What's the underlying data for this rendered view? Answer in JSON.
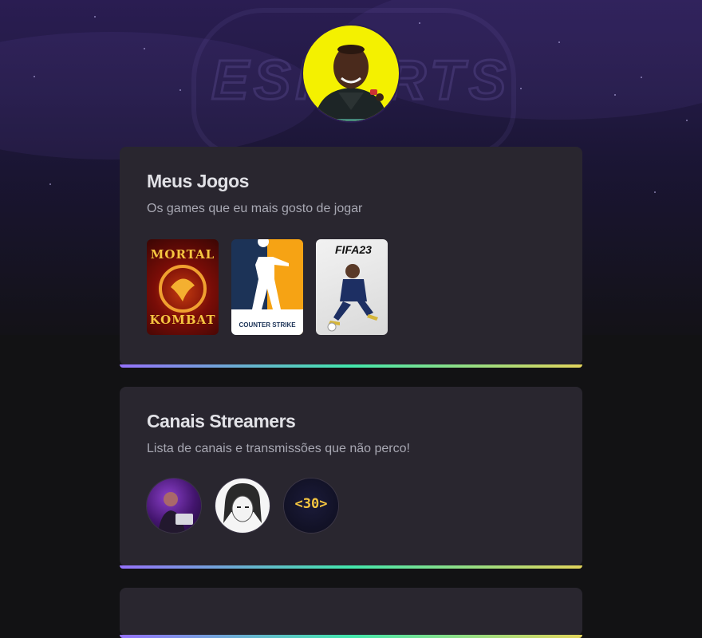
{
  "profile": {
    "avatar_icon": "profile-photo"
  },
  "games_section": {
    "title": "Meus Jogos",
    "subtitle": "Os games que eu mais gosto de jogar",
    "games": [
      {
        "name": "Mortal Kombat",
        "line1": "MORTAL",
        "line2": "KOMBAT"
      },
      {
        "name": "Counter Strike",
        "label": "COUNTER STRIKE"
      },
      {
        "name": "FIFA 23",
        "label": "FIFA23"
      }
    ]
  },
  "streamers_section": {
    "title": "Canais Streamers",
    "subtitle": "Lista de canais e transmissões que não perco!",
    "streamers": [
      {
        "name": "streamer-1"
      },
      {
        "name": "streamer-2"
      },
      {
        "name": "streamer-3",
        "label": "<30>"
      }
    ]
  },
  "colors": {
    "background": "#121214",
    "card": "#29262f",
    "accent_gradient": [
      "#9572fc",
      "#43e7ad",
      "#e2d45c"
    ]
  }
}
